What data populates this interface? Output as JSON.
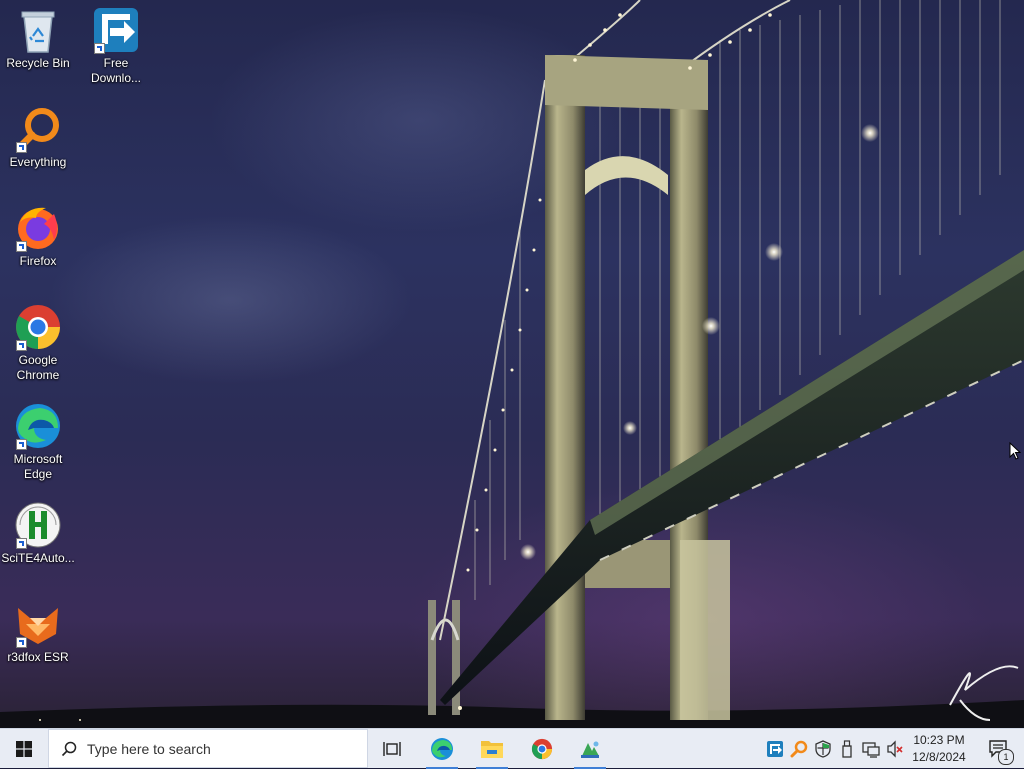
{
  "desktop": {
    "icons": [
      {
        "label": "Recycle Bin",
        "icon": "recycle-bin-icon"
      },
      {
        "label": "Free\nDownlo...",
        "icon": "free-download-manager-icon"
      },
      {
        "label": "Everything",
        "icon": "everything-search-icon"
      },
      {
        "label": "Firefox",
        "icon": "firefox-icon"
      },
      {
        "label": "Google\nChrome",
        "icon": "chrome-icon"
      },
      {
        "label": "Microsoft\nEdge",
        "icon": "edge-icon"
      },
      {
        "label": "SciTE4Auto...",
        "icon": "scite4autoit-icon"
      },
      {
        "label": "r3dfox ESR",
        "icon": "r3dfox-icon"
      }
    ]
  },
  "taskbar": {
    "start_icon": "windows-logo-icon",
    "search_placeholder": "Type here to search",
    "apps": [
      {
        "name": "Task View",
        "icon": "task-view-icon"
      },
      {
        "name": "Microsoft Edge",
        "icon": "edge-icon"
      },
      {
        "name": "File Explorer",
        "icon": "file-explorer-icon"
      },
      {
        "name": "Google Chrome",
        "icon": "chrome-icon"
      },
      {
        "name": "App",
        "icon": "app-icon"
      }
    ],
    "tray": [
      {
        "icon": "free-download-manager-tray-icon"
      },
      {
        "icon": "everything-tray-icon"
      },
      {
        "icon": "security-shield-icon"
      },
      {
        "icon": "usb-device-icon"
      },
      {
        "icon": "network-icon"
      },
      {
        "icon": "volume-muted-icon"
      }
    ],
    "clock": {
      "time": "10:23 PM",
      "date": "12/8/2024"
    },
    "notifications": {
      "icon": "action-center-icon",
      "count": "1"
    }
  },
  "colors": {
    "accent": "#3f7fd6",
    "taskbar_bg": "#e8ecf4"
  }
}
